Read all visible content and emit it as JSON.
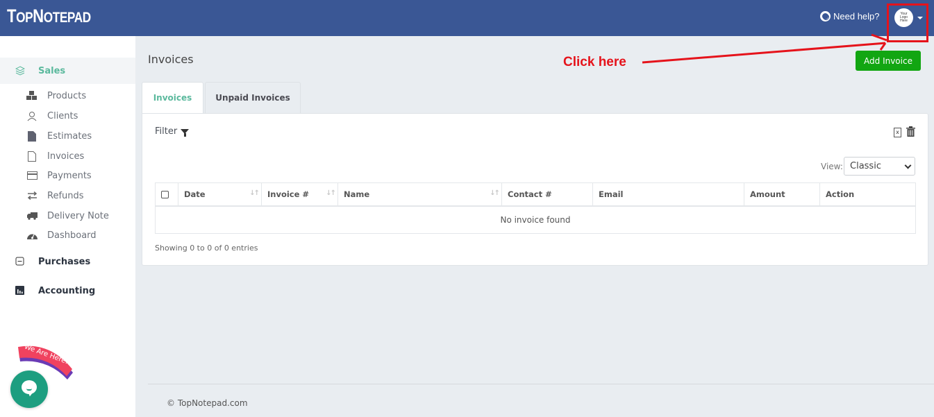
{
  "navbar": {
    "brand_first": "T",
    "brand_rest1": "OP",
    "brand_mid": "N",
    "brand_rest2": "OTEPAD",
    "help_label": "Need help?",
    "logo_text_1": "Your",
    "logo_text_2": "Logo",
    "logo_text_3": "Here",
    "bg_color": "#3a5795"
  },
  "sidebar": {
    "sections": [
      {
        "label": "Sales",
        "icon": "layers-icon",
        "active": true
      },
      {
        "label": "Purchases",
        "icon": "minus-square-icon",
        "active": false
      },
      {
        "label": "Accounting",
        "icon": "bar-chart-icon",
        "active": false
      }
    ],
    "sales_items": [
      {
        "label": "Products",
        "icon": "cubes-icon"
      },
      {
        "label": "Clients",
        "icon": "users-icon"
      },
      {
        "label": "Estimates",
        "icon": "file-filled-icon"
      },
      {
        "label": "Invoices",
        "icon": "file-outline-icon"
      },
      {
        "label": "Payments",
        "icon": "credit-card-icon"
      },
      {
        "label": "Refunds",
        "icon": "exchange-icon"
      },
      {
        "label": "Delivery Note",
        "icon": "truck-icon"
      },
      {
        "label": "Dashboard",
        "icon": "gauge-icon"
      }
    ],
    "accent_color": "#5bb99d"
  },
  "main": {
    "page_title": "Invoices",
    "add_button_label": "Add Invoice",
    "add_button_color": "#12a612",
    "annotation_text": "Click here",
    "annotation_color": "#e5131b",
    "tabs": [
      {
        "label": "Invoices",
        "active": true
      },
      {
        "label": "Unpaid Invoices",
        "active": false
      }
    ],
    "filter_label": "Filter",
    "excel_icon_text": "x",
    "view_label": "View:",
    "view_selected": "Classic",
    "table": {
      "columns": [
        {
          "label": "Date",
          "sortable": true
        },
        {
          "label": "Invoice #",
          "sortable": true
        },
        {
          "label": "Name",
          "sortable": true
        },
        {
          "label": "Contact #",
          "sortable": false
        },
        {
          "label": "Email",
          "sortable": false
        },
        {
          "label": "Amount",
          "sortable": false
        },
        {
          "label": "Action",
          "sortable": false
        }
      ],
      "empty_message": "No invoice found"
    },
    "showing_text": "Showing 0 to 0 of 0 entries"
  },
  "footer": {
    "copyright": "© TopNotepad.com"
  },
  "chat_widget": {
    "badge_text": "We Are Here!"
  }
}
